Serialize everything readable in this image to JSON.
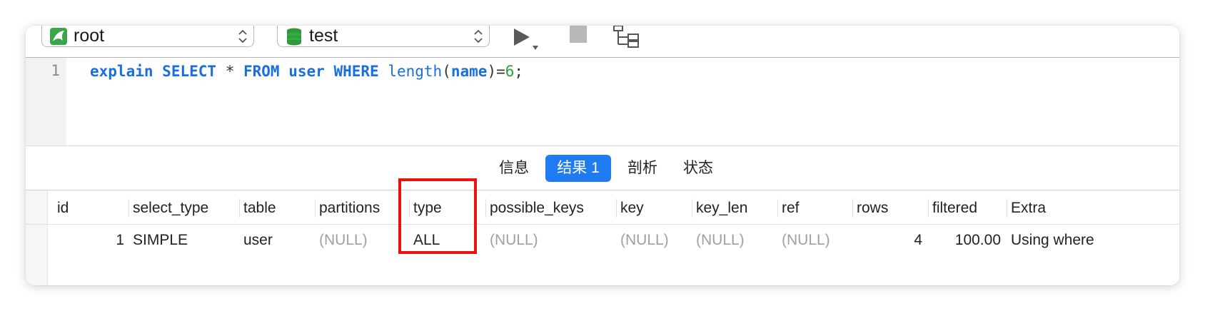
{
  "toolbar": {
    "user_select": {
      "value": "root",
      "icon": "mysql-user-icon"
    },
    "db_select": {
      "value": "test",
      "icon": "database-icon"
    },
    "run_icon": "play-icon",
    "stop_icon": "stop-icon",
    "explain_icon": "explain-tree-icon"
  },
  "editor": {
    "line_number": "1",
    "query": {
      "t1": "explain",
      "t2": "SELECT",
      "t3": "*",
      "t4": "FROM",
      "t5": "user",
      "t6": "WHERE",
      "t7": "length",
      "t8": "(",
      "t9": "name",
      "t10": ")=",
      "t11": "6",
      "t12": ";"
    }
  },
  "tabs": [
    "信息",
    "结果 1",
    "剖析",
    "状态"
  ],
  "active_tab": "结果 1",
  "grid": {
    "columns": [
      "id",
      "select_type",
      "table",
      "partitions",
      "type",
      "possible_keys",
      "key",
      "key_len",
      "ref",
      "rows",
      "filtered",
      "Extra"
    ],
    "rows": [
      [
        "1",
        "SIMPLE",
        "user",
        "(NULL)",
        "ALL",
        "(NULL)",
        "(NULL)",
        "(NULL)",
        "(NULL)",
        "4",
        "100.00",
        "Using where"
      ]
    ]
  },
  "colors": {
    "accent": "#1f7bf2",
    "keyword": "#1a6fe0",
    "number": "#27a23a",
    "highlight": "#ee1111",
    "null_text": "#a0a0a0"
  }
}
